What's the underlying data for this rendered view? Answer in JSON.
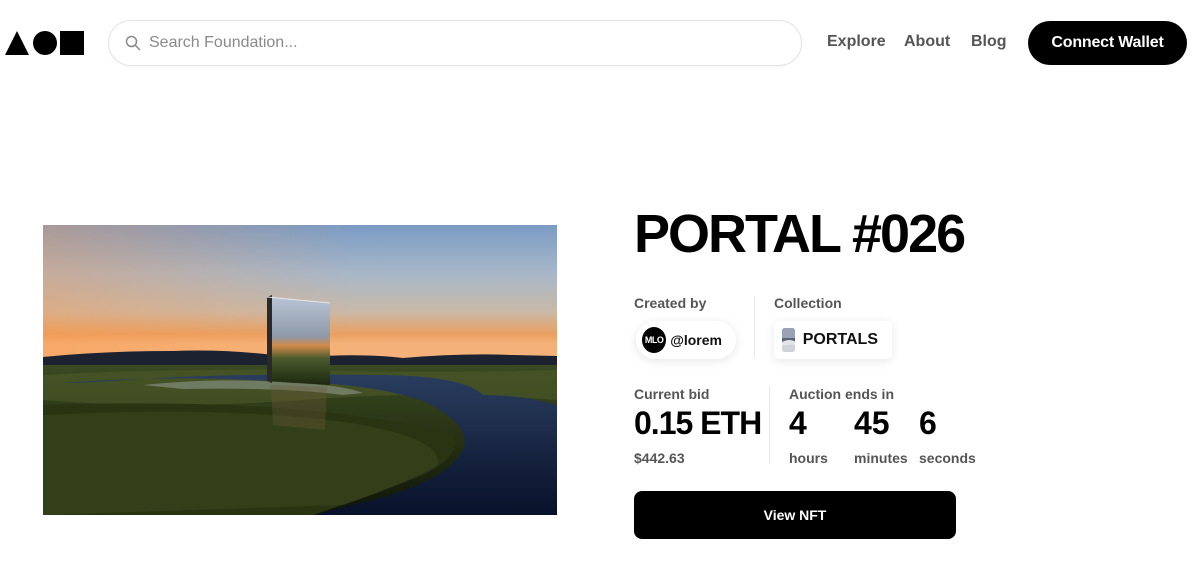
{
  "header": {
    "search_placeholder": "Search Foundation...",
    "nav": [
      "Explore",
      "About",
      "Blog"
    ],
    "connect_label": "Connect Wallet"
  },
  "nft": {
    "title": "PORTAL #026",
    "created_by_label": "Created by",
    "creator_avatar_text": "MLO",
    "creator_handle": "@lorem",
    "collection_label": "Collection",
    "collection_name": "PORTALS",
    "current_bid_label": "Current bid",
    "current_bid_value": "0.15 ETH",
    "current_bid_usd": "$442.63",
    "auction_label": "Auction ends in",
    "countdown": {
      "hours": "4",
      "hours_label": "hours",
      "minutes": "45",
      "minutes_label": "minutes",
      "seconds": "6",
      "seconds_label": "seconds"
    },
    "view_button_label": "View NFT"
  },
  "icons": {
    "logo": "foundation-logo-icon",
    "search": "search-icon"
  },
  "colors": {
    "primary": "#000000",
    "text_muted": "#555555"
  }
}
